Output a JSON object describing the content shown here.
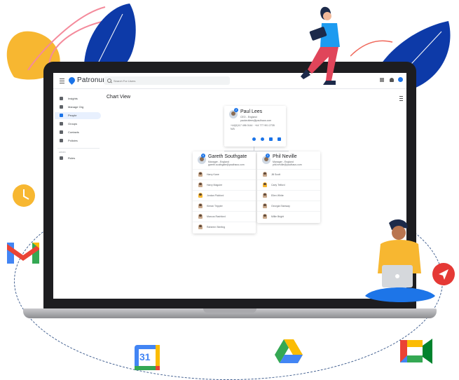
{
  "app": {
    "name": "Patronum",
    "search_placeholder": "Search For Users"
  },
  "sidebar": {
    "items": [
      {
        "label": "Insights",
        "icon": "chart-icon"
      },
      {
        "label": "Manage Org",
        "icon": "org-icon"
      },
      {
        "label": "People",
        "icon": "person-icon",
        "active": true
      },
      {
        "label": "Groups",
        "icon": "groups-icon"
      },
      {
        "label": "Contacts",
        "icon": "contacts-icon"
      },
      {
        "label": "Policies",
        "icon": "policy-icon"
      }
    ],
    "section_label": "ADMIN",
    "admin_items": [
      {
        "label": "Roles",
        "icon": "roles-icon"
      }
    ]
  },
  "main": {
    "title": "Chart View"
  },
  "chart": {
    "root": {
      "name": "Paul Lees",
      "title": "CEO - England",
      "email": "paulcrutlees@paulhaus.com",
      "phone": "+44(0)117 496 0144 · +44 777 901 2735",
      "location": "N/A",
      "reports_count": "2"
    },
    "managers": [
      {
        "name": "Gareth Southgate",
        "title": "Manager - England",
        "email": "gareth.southgate@paulhaus.com",
        "reports_count": "6",
        "reports": [
          "Harry Kane",
          "Harry Maguire",
          "Jordan Pickford",
          "Kieran Trippier",
          "Marcus Rashford",
          "Raheem Sterling"
        ]
      },
      {
        "name": "Phil Neville",
        "title": "Manager - England",
        "email": "phil.neville@paulhaus.com",
        "reports_count": "5",
        "reports": [
          "Jill Scott",
          "Carly Telford",
          "Ellen White",
          "Georgia Stanway",
          "Millie Bright"
        ]
      }
    ]
  },
  "floating_logos": [
    "clock-logo",
    "gmail-logo",
    "calendar-logo",
    "drive-logo",
    "meet-logo",
    "arrow-logo"
  ],
  "calendar_day": "31",
  "colors": {
    "brand_blue": "#1a73e8",
    "leaf_navy": "#0d3aa8",
    "leaf_yellow": "#f7b731",
    "leaf_pink": "#f48a9b",
    "leaf_coral": "#f06a5d"
  }
}
